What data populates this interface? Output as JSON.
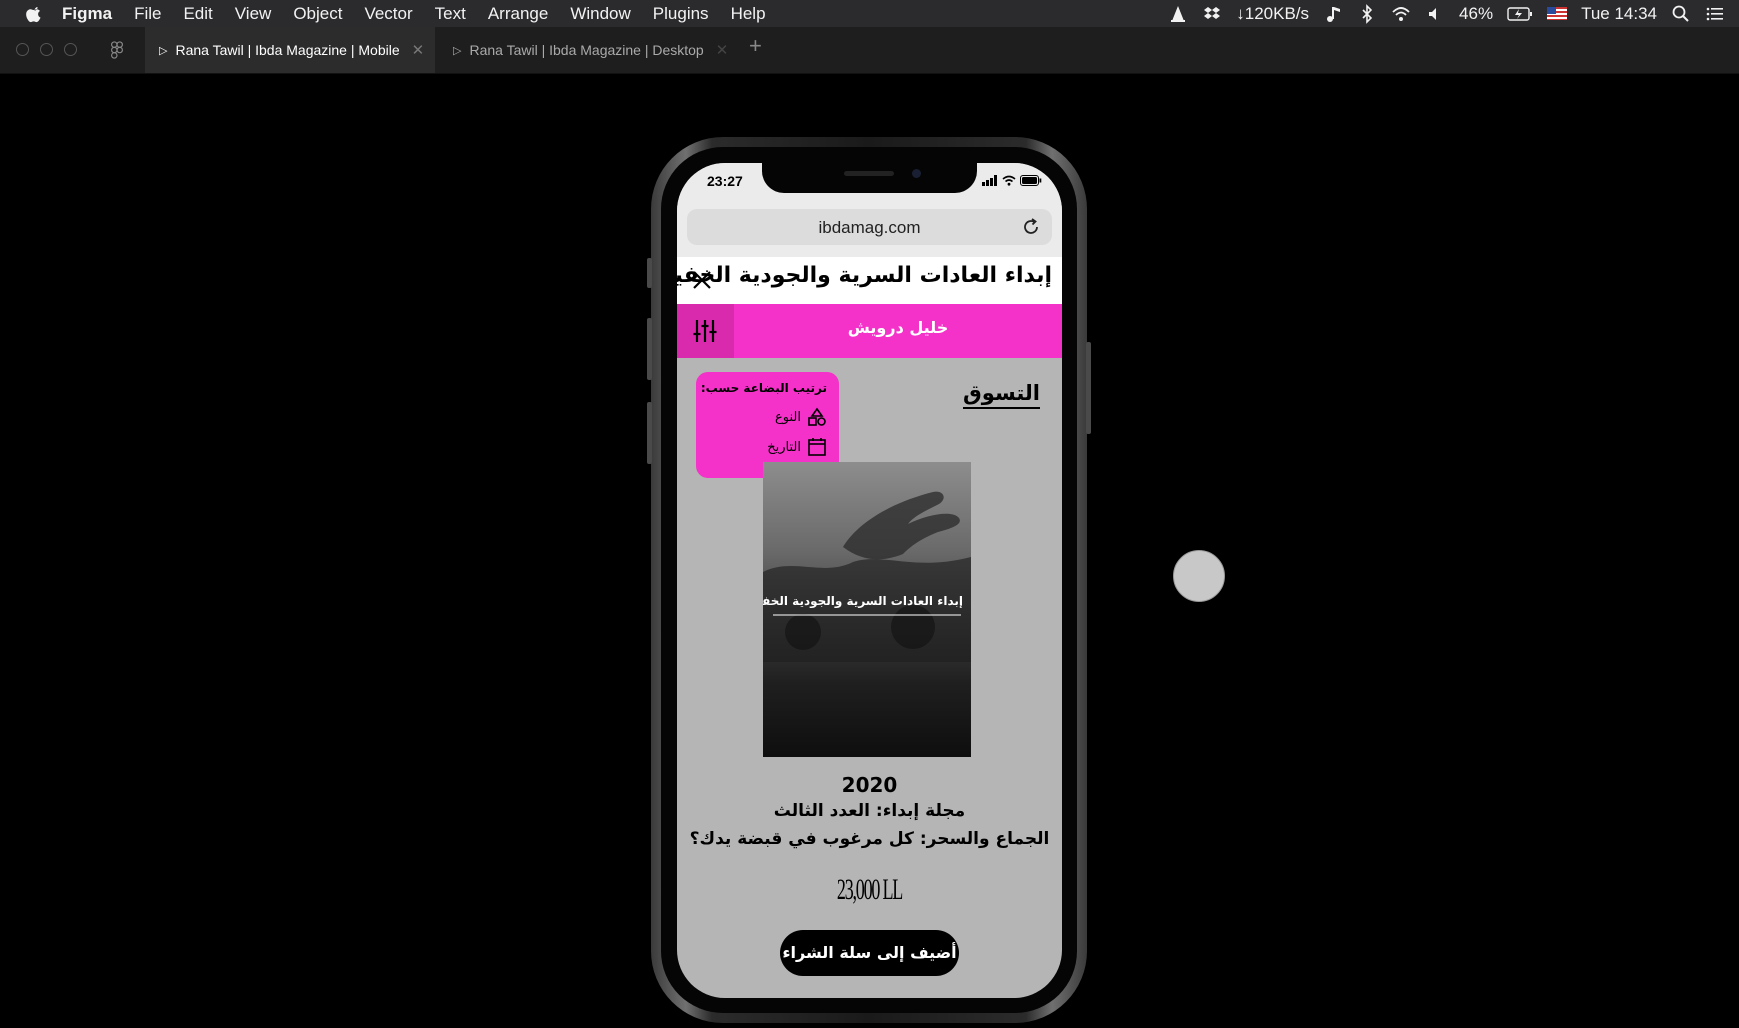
{
  "menubar": {
    "app_name": "Figma",
    "items": [
      "File",
      "Edit",
      "View",
      "Object",
      "Vector",
      "Text",
      "Arrange",
      "Window",
      "Plugins",
      "Help"
    ],
    "network_speed": "↓120KB/s",
    "battery": "46%",
    "clock": "Tue 14:34"
  },
  "tabs": [
    {
      "label": "Rana Tawil | Ibda Magazine | Mobile",
      "active": true
    },
    {
      "label": "Rana Tawil | Ibda Magazine | Desktop",
      "active": false
    }
  ],
  "phone": {
    "time": "23:27",
    "url": "ibdamag.com",
    "magazine_title": "إبداء العادات السرية والجودية الخفية",
    "author": "خليل درويش",
    "section_title": "التسوق",
    "sort": {
      "heading": "ترتيب البضاعة حسب:",
      "option_type": "النوع",
      "option_date": "التاريخ"
    },
    "product": {
      "cover_title": "إبداء العادات السرية والجودية الخفية",
      "year": "2020",
      "issue": "مجلة إبداء: العدد الثالث",
      "subtitle": "الجماع والسحر: كل مرغوب في قبضة يدك؟",
      "price": "23,000 LL",
      "cart_label": "أضيف إلى سلة الشراء"
    }
  },
  "colors": {
    "accent_pink": "#f431c8",
    "accent_pink_dark": "#d929ad",
    "screen_bg": "#b5b5b5"
  }
}
